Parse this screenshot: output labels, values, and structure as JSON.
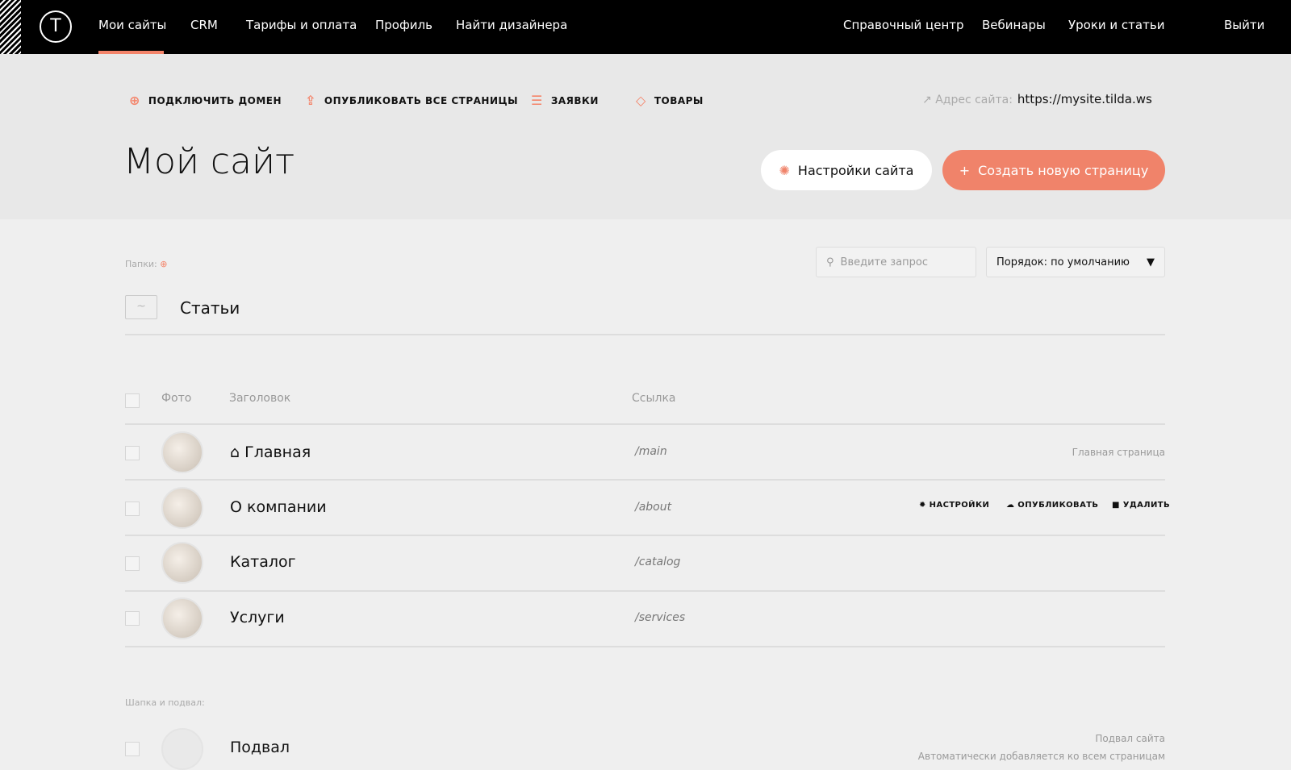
{
  "nav": {
    "logo": "T",
    "left": [
      "Мои сайты",
      "CRM",
      "Тарифы и оплата",
      "Профиль",
      "Найти дизайнера"
    ],
    "right": [
      "Справочный центр",
      "Вебинары",
      "Уроки и статьи",
      "Выйти"
    ]
  },
  "toolbar": {
    "domain": "ПОДКЛЮЧИТЬ ДОМЕН",
    "publish_all": "ОПУБЛИКОВАТЬ ВСЕ СТРАНИЦЫ",
    "leads": "ЗАЯВКИ",
    "products": "ТОВАРЫ",
    "address_label": "Адрес сайта:",
    "address": "https://mysite.tilda.ws"
  },
  "site": {
    "title": "Мой сайт",
    "settings": "Настройки сайта",
    "create": "Создать новую страницу"
  },
  "folders": {
    "label": "Папки:",
    "items": [
      "Статьи"
    ]
  },
  "search": {
    "placeholder": "Введите запрос"
  },
  "sort": {
    "value": "Порядок: по умолчанию"
  },
  "table": {
    "headers": [
      "Фото",
      "Заголовок",
      "Ссылка"
    ],
    "rows": [
      {
        "title": "Главная",
        "link": "/main",
        "note": "Главная страница"
      },
      {
        "title": "О компании",
        "link": "/about"
      },
      {
        "title": "Каталог",
        "link": "/catalog"
      },
      {
        "title": "Услуги",
        "link": "/services"
      }
    ],
    "actions": {
      "settings": "НАСТРОЙКИ",
      "publish": "ОПУБЛИКОВАТЬ",
      "delete": "УДАЛИТЬ"
    }
  },
  "headers_footers": {
    "label": "Шапка и подвал:",
    "footer": {
      "title": "Подвал",
      "note1": "Подвал сайта",
      "note2": "Автоматически добавляется ко всем страницам"
    }
  },
  "colors": {
    "accent": "#f0836a"
  }
}
